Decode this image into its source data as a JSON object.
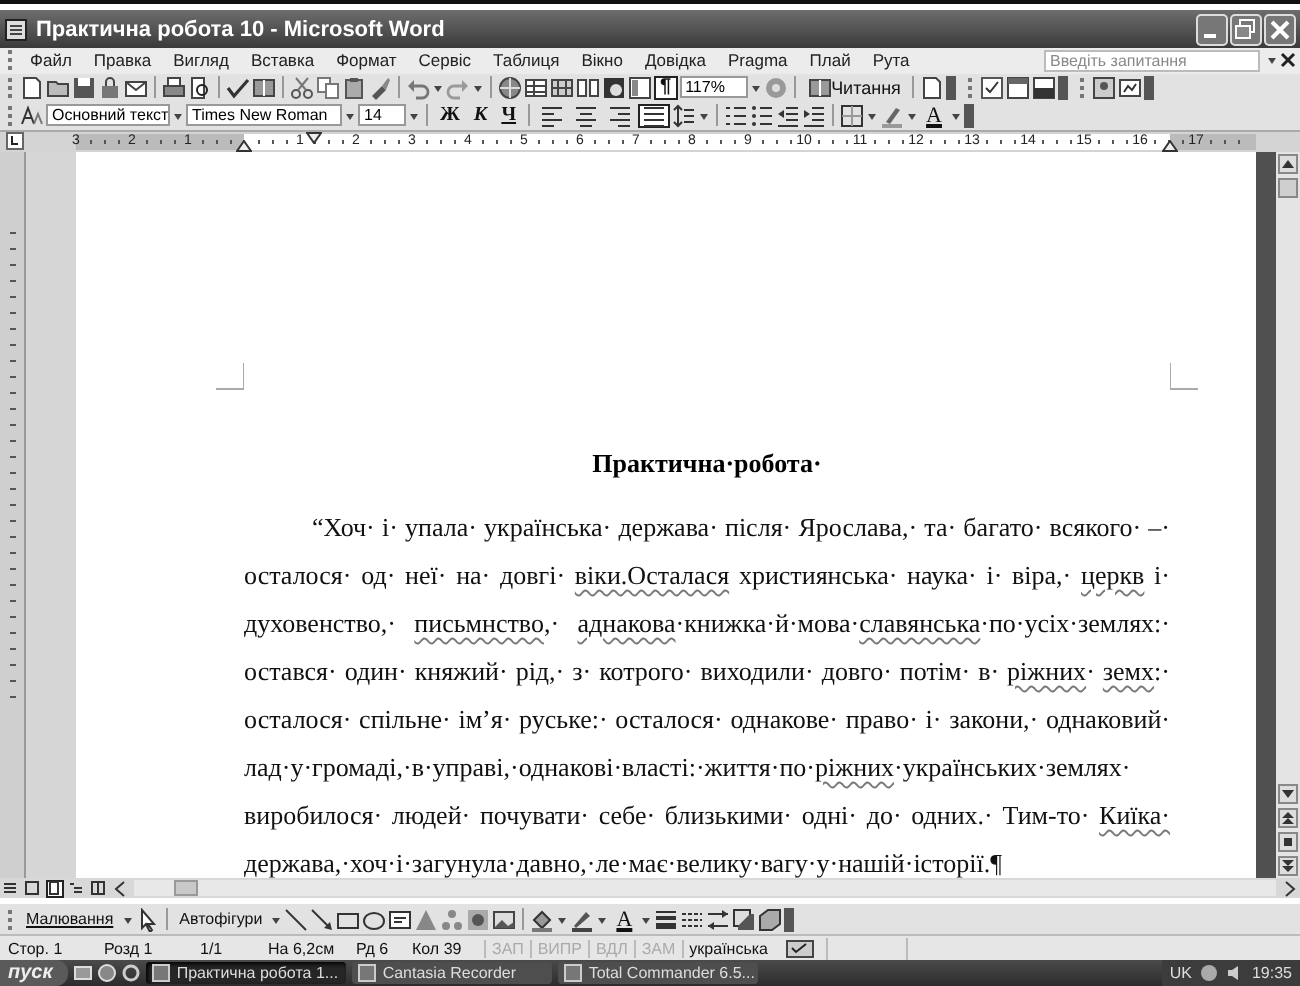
{
  "window": {
    "title": "Практична робота 10 - Microsoft Word"
  },
  "menu": {
    "items": [
      "Файл",
      "Правка",
      "Вигляд",
      "Вставка",
      "Формат",
      "Сервіс",
      "Таблиця",
      "Вікно",
      "Довідка",
      "Pragma",
      "Плай",
      "Рута"
    ],
    "help_placeholder": "Введіть запитання"
  },
  "standard_toolbar": {
    "show_marks": {
      "label": "¶",
      "pressed": true
    },
    "zoom": "117%",
    "reading": "Читання"
  },
  "formatting_toolbar": {
    "style": "Основний текст",
    "font": "Times New Roman",
    "size": "14",
    "bold": "Ж",
    "italic": "К",
    "underline": "Ч",
    "alignment": [
      {
        "selected": false
      },
      {
        "selected": false
      },
      {
        "selected": false
      },
      {
        "selected": true
      }
    ],
    "font_color": "A"
  },
  "ruler": {
    "left_labels": [
      "3",
      "2",
      "1"
    ],
    "right_labels": [
      "1",
      "2",
      "3",
      "4",
      "5",
      "6",
      "7",
      "8",
      "9",
      "10",
      "11",
      "12",
      "13",
      "14",
      "15",
      "16",
      "17"
    ]
  },
  "document": {
    "heading": "Практична·робота·",
    "lines": [
      {
        "indent": true,
        "segments": [
          {
            "text": "“Хоч· і· упала· українська· держава· після· Ярослава,· та· багато· всякого· –·",
            "flagged": false
          }
        ]
      },
      {
        "indent": false,
        "segments": [
          {
            "text": "осталося· од· неї· на· довгі· ",
            "flagged": false
          },
          {
            "text": "віки.Осталася",
            "flagged": true
          },
          {
            "text": " християнська· наука· і· віра,· ",
            "flagged": false
          },
          {
            "text": "церкв",
            "flagged": true
          },
          {
            "text": " і·",
            "flagged": false
          }
        ]
      },
      {
        "indent": false,
        "segments": [
          {
            "text": "духовенство,· ",
            "flagged": false
          },
          {
            "text": "письмнство",
            "flagged": true
          },
          {
            "text": ",· ",
            "flagged": false
          },
          {
            "text": "аднакова",
            "flagged": true
          },
          {
            "text": "·книжка·й·мова·",
            "flagged": false
          },
          {
            "text": "славянська",
            "flagged": true
          },
          {
            "text": "·по·усіх·землях:·",
            "flagged": false
          }
        ]
      },
      {
        "indent": false,
        "segments": [
          {
            "text": "остався· один· княжий· рід,· з· котрого· виходили· довго· потім· в· ",
            "flagged": false
          },
          {
            "text": "ріжних",
            "flagged": true
          },
          {
            "text": "· ",
            "flagged": false
          },
          {
            "text": "земх",
            "flagged": true
          },
          {
            "text": ":·",
            "flagged": false
          }
        ]
      },
      {
        "indent": false,
        "segments": [
          {
            "text": "осталося· спільне· ім’я· руське:· осталося· однакове· право· і· закони,· однаковий·",
            "flagged": false
          }
        ]
      },
      {
        "indent": false,
        "segments": [
          {
            "text": "лад·у·громаді,·в·управі,·однакові·власті:·життя·по·",
            "flagged": false
          },
          {
            "text": "ріжних",
            "flagged": true
          },
          {
            "text": "·українських·землях·",
            "flagged": false
          }
        ]
      },
      {
        "indent": false,
        "segments": [
          {
            "text": "виробилося· людей· почувати· себе· близькими· одні· до· одних.· Тим-то· ",
            "flagged": false
          },
          {
            "text": "Киїка·",
            "flagged": true
          }
        ]
      },
      {
        "indent": false,
        "segments": [
          {
            "text": "держава,·хоч·і·загунула·давно,·ле·має·велику·вагу·у·нашій·історії.¶",
            "flagged": false
          }
        ]
      }
    ]
  },
  "drawing_toolbar": {
    "drawing": "Малювання",
    "autoshapes": "Автофігури",
    "font_color": "A"
  },
  "status_bar": {
    "page": "Стор. 1",
    "section": "Розд 1",
    "pages": "1/1",
    "position": "На 6,2см",
    "line": "Рд 6",
    "column": "Кол 39",
    "modes": [
      {
        "label": "ЗАП",
        "active": false
      },
      {
        "label": "ВИПР",
        "active": false
      },
      {
        "label": "ВДЛ",
        "active": false
      },
      {
        "label": "ЗАМ",
        "active": false
      }
    ],
    "language": "українська"
  },
  "taskbar": {
    "start": "пуск",
    "tasks": [
      {
        "label": "Практична робота 1...",
        "selected": true
      },
      {
        "label": "Cantasia Recorder",
        "selected": false
      },
      {
        "label": "Total Commander 6.5...",
        "selected": false
      }
    ],
    "language": "UK",
    "clock": "19:35"
  }
}
